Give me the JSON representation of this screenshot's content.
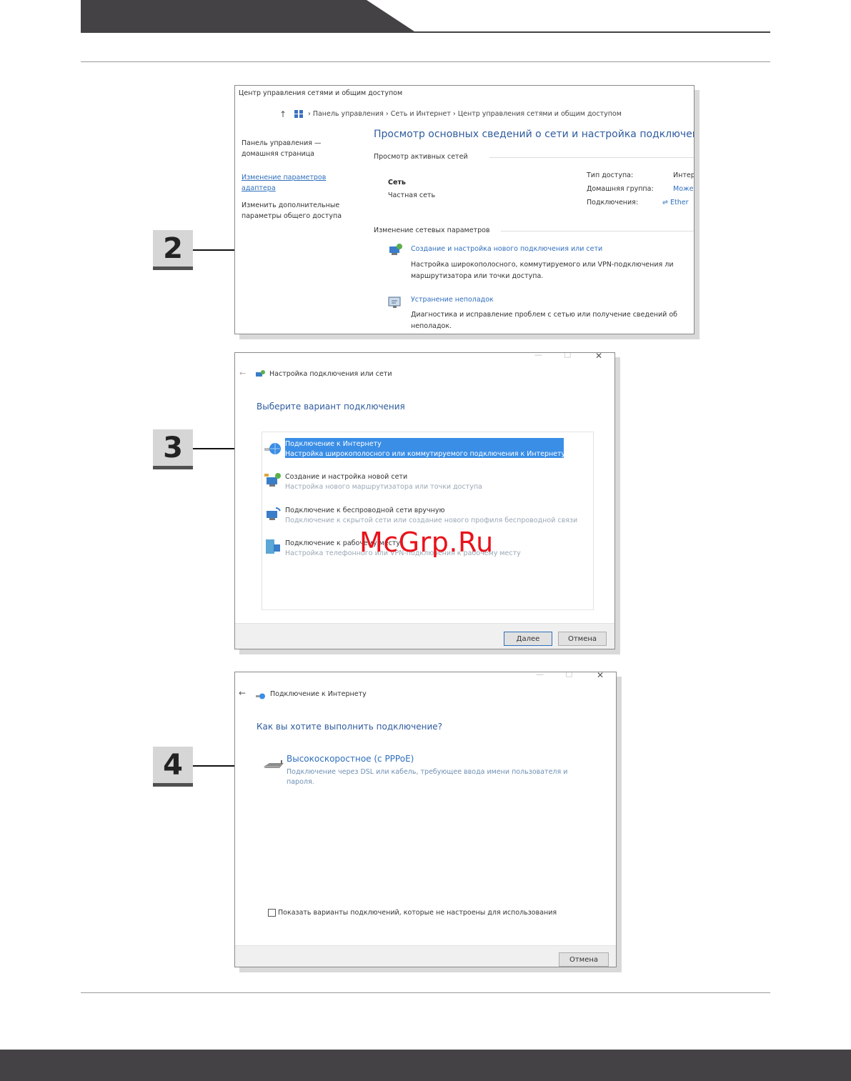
{
  "watermark": "McGrp.Ru",
  "steps": [
    "2",
    "3",
    "4"
  ],
  "win1": {
    "title": "Центр управления сетями и общим доступом",
    "breadcrumb": [
      "Панель управления",
      "Сеть и Интернет",
      "Центр управления сетями и общим доступом"
    ],
    "sidebar": {
      "home_l1": "Панель управления —",
      "home_l2": "домашняя страница",
      "adapter_l1": "Изменение параметров",
      "adapter_l2": "адаптера",
      "sharing_l1": "Изменить дополнительные",
      "sharing_l2": "параметры общего доступа"
    },
    "heading": "Просмотр основных сведений о сети и настройка подключений",
    "active_networks": "Просмотр активных сетей",
    "network_name": "Сеть",
    "network_type": "Частная сеть",
    "access_type_label": "Тип доступа:",
    "access_type_value": "Интер",
    "homegroup_label": "Домашняя группа:",
    "homegroup_value": "Може",
    "connections_label": "Подключения:",
    "connections_value": "Ether",
    "change_settings": "Изменение сетевых параметров",
    "new_conn_link": "Создание и настройка нового подключения или сети",
    "new_conn_desc_l1": "Настройка широкополосного, коммутируемого или VPN-подключения ли",
    "new_conn_desc_l2": "маршрутизатора или точки доступа.",
    "troubleshoot_link": "Устранение неполадок",
    "troubleshoot_desc_l1": "Диагностика и исправление проблем с сетью или получение сведений об",
    "troubleshoot_desc_l2": "неполадок."
  },
  "win2": {
    "title": "Настройка подключения или сети",
    "heading": "Выберите вариант подключения",
    "options": [
      {
        "title": "Подключение к Интернету",
        "desc": "Настройка широкополосного или коммутируемого подключения к Интернету"
      },
      {
        "title": "Создание и настройка новой сети",
        "desc": "Настройка нового маршрутизатора или точки доступа"
      },
      {
        "title": "Подключение к беспроводной сети вручную",
        "desc": "Подключение к скрытой сети или создание нового профиля беспроводной связи"
      },
      {
        "title": "Подключение к рабочему месту",
        "desc": "Настройка телефонного или VPN-подключения к рабочему месту"
      }
    ],
    "next": "Далее",
    "cancel": "Отмена"
  },
  "win3": {
    "title": "Подключение к Интернету",
    "heading": "Как вы хотите выполнить подключение?",
    "option_title": "Высокоскоростное (с PPPoE)",
    "option_desc_l1": "Подключение через DSL или кабель, требующее ввода имени пользователя и",
    "option_desc_l2": "пароля.",
    "checkbox": "Показать варианты подключений, которые не настроены для использования",
    "cancel": "Отмена"
  },
  "colors": {
    "dark": "#444245",
    "accent_blue": "#2f6fbd",
    "select_blue": "#3a8ee6",
    "watermark": "#e8121b"
  }
}
